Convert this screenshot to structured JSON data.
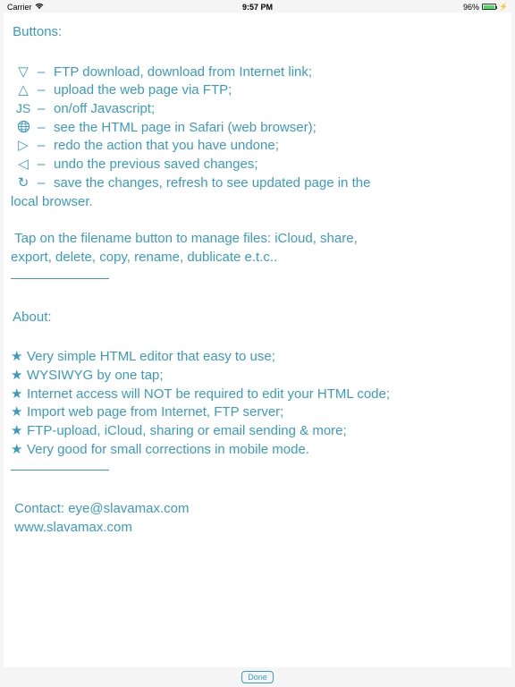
{
  "status_bar": {
    "carrier": "Carrier",
    "time": "9:57 PM",
    "battery_percent": "96%"
  },
  "buttons_section": {
    "title": "Buttons:",
    "items": [
      {
        "icon": "▽",
        "desc": "FTP download, download from Internet link;"
      },
      {
        "icon": "△",
        "desc": "upload the web page via FTP;"
      },
      {
        "icon": "JS",
        "desc": "on/off Javascript;"
      },
      {
        "icon": "globe",
        "desc": "see the HTML page in Safari (web browser);"
      },
      {
        "icon": "▷",
        "desc": "redo the action that you have undone;"
      },
      {
        "icon": "◁",
        "desc": "undo the previous saved changes;"
      },
      {
        "icon": "↻",
        "desc": "save the changes, refresh to see updated page in the"
      }
    ],
    "last_wrap": "local browser."
  },
  "tap_paragraph": {
    "line1": "Tap on the filename button to manage files: iCloud, share,",
    "line2": "export, delete, copy, rename, dublicate e.t.c.."
  },
  "about_section": {
    "title": "About:",
    "items": [
      "Very simple HTML editor that easy to use;",
      "WYSIWYG by one tap;",
      "Internet access will NOT be required to edit your HTML code;",
      "Import web page from Internet, FTP server;",
      "FTP-upload, iCloud, sharing or email sending & more;",
      "Very good for small corrections in mobile mode."
    ]
  },
  "contact": {
    "line1": "Contact: eye@slavamax.com",
    "line2": "www.slavamax.com"
  },
  "done_label": "Done"
}
